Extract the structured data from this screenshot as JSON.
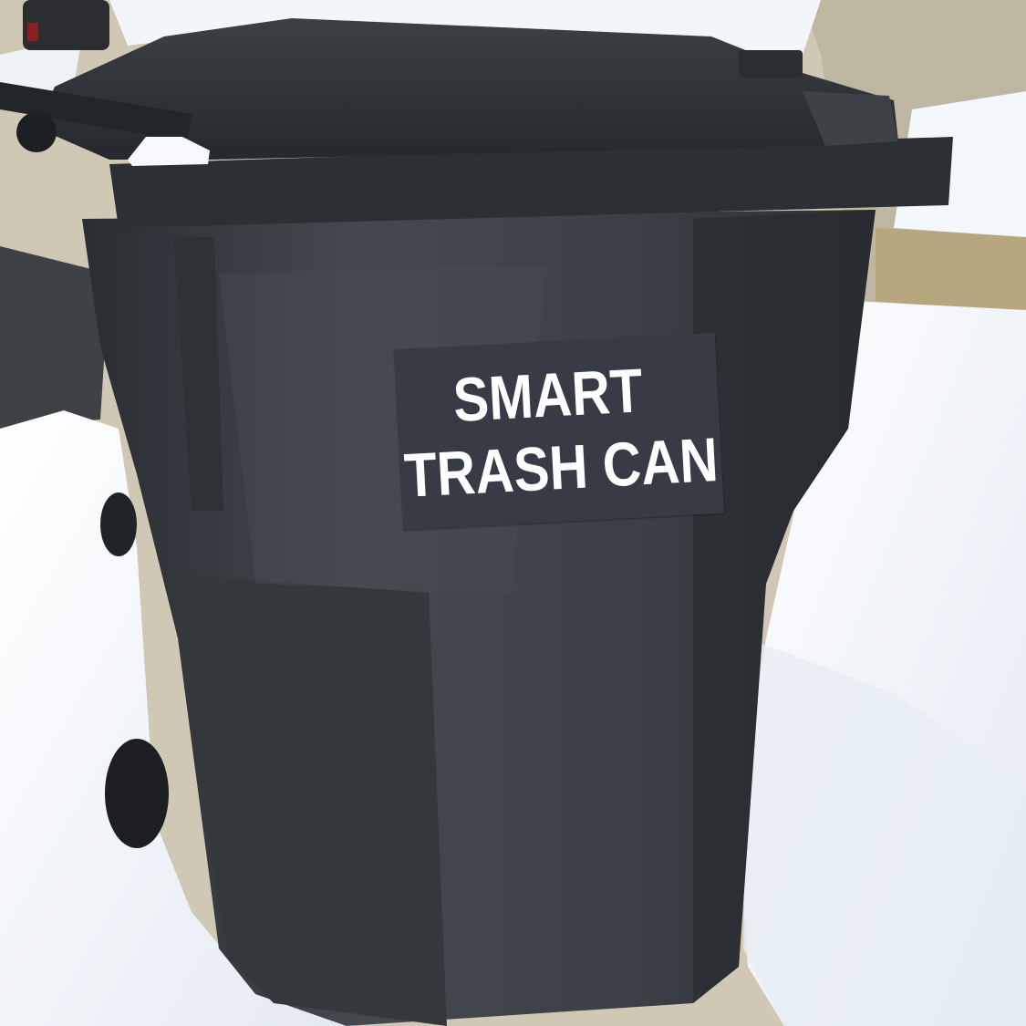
{
  "label": {
    "line1": "SMART",
    "line2": "TRASH CAN"
  },
  "colors": {
    "label_background": "#363b46",
    "label_text": "#ffffff",
    "bin_body": "#3a3f45",
    "snow": "#f4f7fb",
    "pavement": "#c9c1ab"
  }
}
